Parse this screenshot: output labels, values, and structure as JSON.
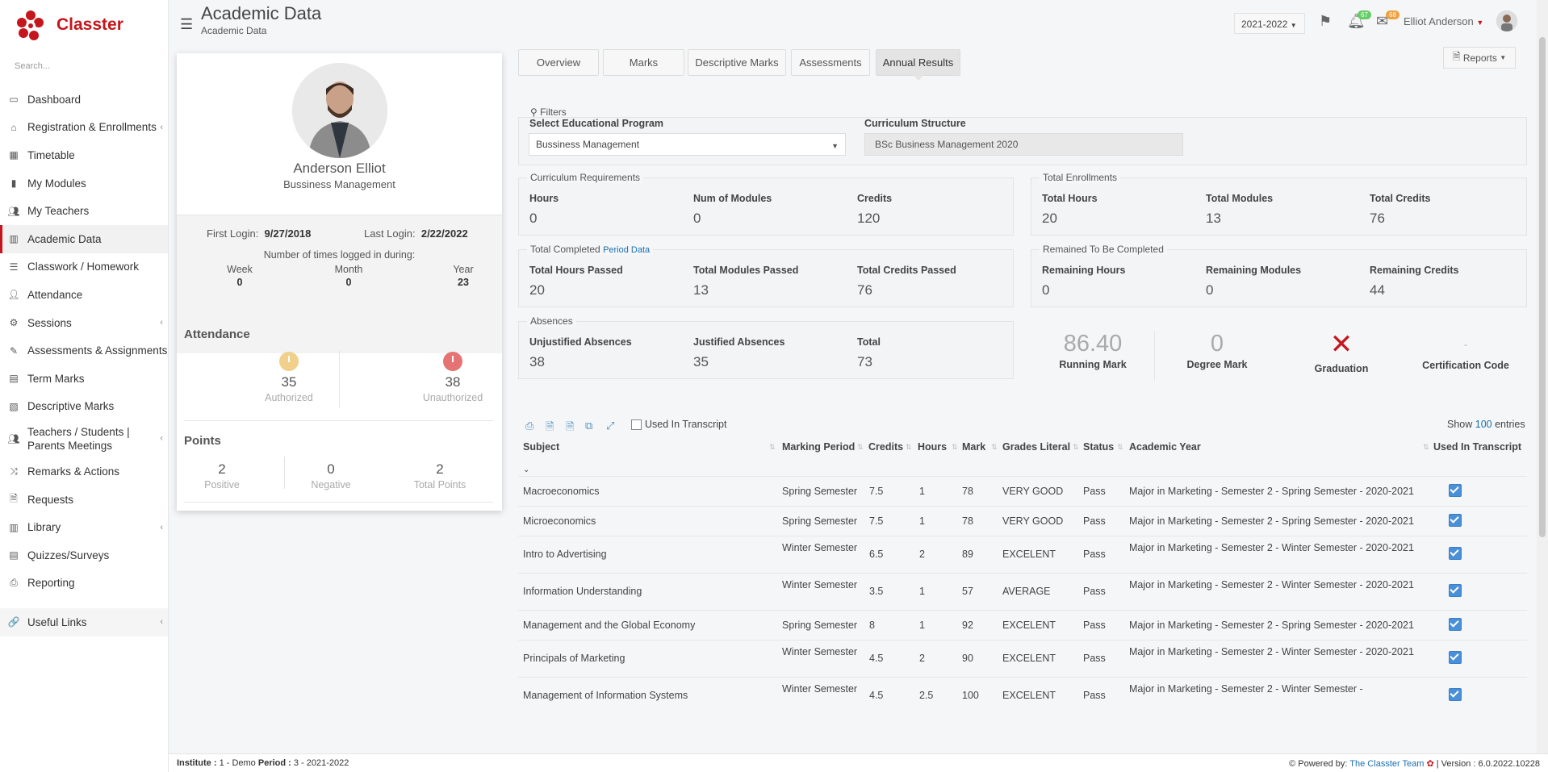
{
  "app": {
    "name": "Classter",
    "brand_color": "#c4161c"
  },
  "sidebar": {
    "search_placeholder": "Search...",
    "items": [
      {
        "label": "Dashboard",
        "icon": "laptop-icon",
        "chev": false
      },
      {
        "label": "Registration & Enrollments",
        "icon": "bank-icon",
        "chev": true
      },
      {
        "label": "Timetable",
        "icon": "calendar-icon",
        "chev": false
      },
      {
        "label": "My Modules",
        "icon": "book-icon",
        "chev": false
      },
      {
        "label": "My Teachers",
        "icon": "users-icon",
        "chev": false
      },
      {
        "label": "Academic Data",
        "icon": "chart-icon",
        "chev": false,
        "active": true
      },
      {
        "label": "Classwork / Homework",
        "icon": "list-icon",
        "chev": false
      },
      {
        "label": "Attendance",
        "icon": "user-check-icon",
        "chev": false
      },
      {
        "label": "Sessions",
        "icon": "sessions-icon",
        "chev": true
      },
      {
        "label": "Assessments & Assignments",
        "icon": "edit-icon",
        "chev": false
      },
      {
        "label": "Term Marks",
        "icon": "term-icon",
        "chev": false
      },
      {
        "label": "Descriptive Marks",
        "icon": "desc-icon",
        "chev": false
      },
      {
        "label": "Teachers / Students | Parents Meetings",
        "icon": "meeting-icon",
        "chev": true,
        "tall": true
      },
      {
        "label": "Remarks & Actions",
        "icon": "remarks-icon",
        "chev": false
      },
      {
        "label": "Requests",
        "icon": "file-icon",
        "chev": false
      },
      {
        "label": "Library",
        "icon": "library-icon",
        "chev": true
      },
      {
        "label": "Quizzes/Surveys",
        "icon": "quiz-icon",
        "chev": false
      },
      {
        "label": "Reporting",
        "icon": "print-icon",
        "chev": false
      }
    ],
    "useful_links": "Useful Links"
  },
  "header": {
    "title": "Academic Data",
    "subtitle": "Academic Data",
    "year": "2021-2022",
    "notif_count": "67",
    "mail_count": "68",
    "user_name": "Elliot Anderson"
  },
  "profile": {
    "name": "Anderson Elliot",
    "program": "Bussiness Management",
    "first_login_label": "First Login:",
    "first_login": "9/27/2018",
    "last_login_label": "Last Login:",
    "last_login": "2/22/2022",
    "times_label": "Number of times logged in during:",
    "week_label": "Week",
    "week": "0",
    "month_label": "Month",
    "month": "0",
    "year_label": "Year",
    "year": "23",
    "attendance_title": "Attendance",
    "authorized": "35",
    "authorized_label": "Authorized",
    "unauthorized": "38",
    "unauthorized_label": "Unauthorized",
    "points_title": "Points",
    "positive": "2",
    "positive_label": "Positive",
    "negative": "0",
    "negative_label": "Negative",
    "total_points": "2",
    "total_points_label": "Total Points"
  },
  "tabs": [
    "Overview",
    "Marks",
    "Descriptive Marks",
    "Assessments",
    "Annual Results"
  ],
  "reports_label": "Reports",
  "filters": {
    "legend": "Filters",
    "program_label": "Select Educational Program",
    "program_value": "Bussiness Management",
    "curriculum_label": "Curriculum Structure",
    "curriculum_value": "BSc Business Management 2020"
  },
  "curriculum": {
    "legend": "Curriculum Requirements",
    "hours_label": "Hours",
    "hours": "0",
    "modules_label": "Num of Modules",
    "modules": "0",
    "credits_label": "Credits",
    "credits": "120"
  },
  "enrollments": {
    "legend": "Total Enrollments",
    "hours_label": "Total Hours",
    "hours": "20",
    "modules_label": "Total Modules",
    "modules": "13",
    "credits_label": "Total Credits",
    "credits": "76"
  },
  "completed": {
    "legend": "Total Completed",
    "link": "Period Data",
    "hours_label": "Total Hours Passed",
    "hours": "20",
    "modules_label": "Total Modules Passed",
    "modules": "13",
    "credits_label": "Total Credits Passed",
    "credits": "76"
  },
  "remaining": {
    "legend": "Remained To Be Completed",
    "hours_label": "Remaining Hours",
    "hours": "0",
    "modules_label": "Remaining Modules",
    "modules": "0",
    "credits_label": "Remaining Credits",
    "credits": "44"
  },
  "absences": {
    "legend": "Absences",
    "unjustified_label": "Unjustified Absences",
    "unjustified": "38",
    "justified_label": "Justified Absences",
    "justified": "35",
    "total_label": "Total",
    "total": "73"
  },
  "marks": {
    "running": "86.40",
    "running_label": "Running Mark",
    "degree": "0",
    "degree_label": "Degree Mark",
    "graduation_label": "Graduation",
    "certification": "-",
    "certification_label": "Certification Code"
  },
  "table": {
    "used_in_transcript_filter": "Used In Transcript",
    "show_label": "Show",
    "show_value": "100",
    "entries_label": "entries",
    "columns": [
      "Subject",
      "Marking Period",
      "Credits",
      "Hours",
      "Mark",
      "Grades Literal",
      "Status",
      "Academic Year",
      "Used In Transcript"
    ],
    "rows": [
      {
        "subject": "Macroeconomics",
        "period": "Spring Semester",
        "credits": "7.5",
        "hours": "1",
        "mark": "78",
        "grade": "VERY GOOD",
        "status": "Pass",
        "year": "Major in Marketing - Semester 2 - Spring Semester - 2020-2021"
      },
      {
        "subject": "Microeconomics",
        "period": "Spring Semester",
        "credits": "7.5",
        "hours": "1",
        "mark": "78",
        "grade": "VERY GOOD",
        "status": "Pass",
        "year": "Major in Marketing - Semester 2 - Spring Semester - 2020-2021"
      },
      {
        "subject": "Intro to Advertising",
        "period": "Winter Semester",
        "credits": "6.5",
        "hours": "2",
        "mark": "89",
        "grade": "EXCELENT",
        "status": "Pass",
        "year": "Major in Marketing - Semester 2 - Winter Semester - 2020-2021"
      },
      {
        "subject": "Information Understanding",
        "period": "Winter Semester",
        "credits": "3.5",
        "hours": "1",
        "mark": "57",
        "grade": "AVERAGE",
        "status": "Pass",
        "year": "Major in Marketing - Semester 2 - Winter Semester - 2020-2021"
      },
      {
        "subject": "Management and the Global Economy",
        "period": "Spring Semester",
        "credits": "8",
        "hours": "1",
        "mark": "92",
        "grade": "EXCELENT",
        "status": "Pass",
        "year": "Major in Marketing - Semester 2 - Spring Semester - 2020-2021"
      },
      {
        "subject": "Principals of Marketing",
        "period": "Winter Semester",
        "credits": "4.5",
        "hours": "2",
        "mark": "90",
        "grade": "EXCELENT",
        "status": "Pass",
        "year": "Major in Marketing - Semester 2 - Winter Semester - 2020-2021"
      },
      {
        "subject": "Management of Information Systems",
        "period": "Winter Semester",
        "credits": "4.5",
        "hours": "2.5",
        "mark": "100",
        "grade": "EXCELENT",
        "status": "Pass",
        "year": "Major in Marketing - Semester 2 - Winter Semester -"
      }
    ]
  },
  "footer": {
    "institute_label": "Institute :",
    "institute": "1 - Demo",
    "period_label": "Period :",
    "period": "3 - 2021-2022",
    "powered": "Powered by:",
    "team": "The Classter Team",
    "version": "| Version : 6.0.2022.10228"
  }
}
